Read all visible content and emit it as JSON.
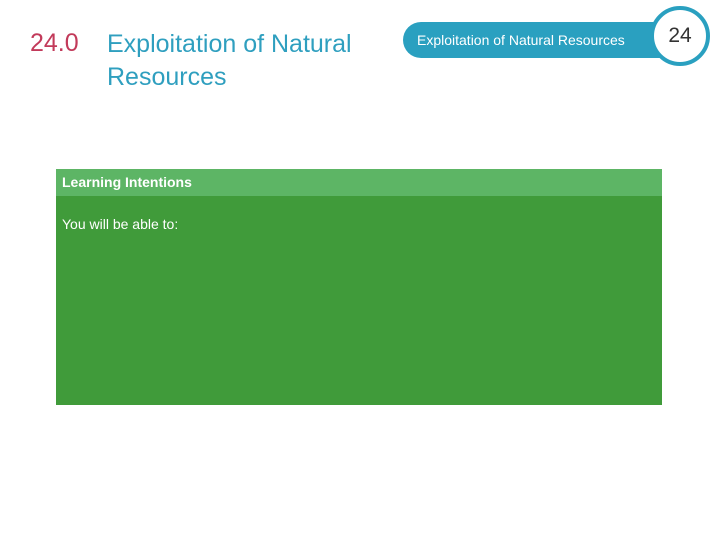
{
  "title": {
    "number": "24.0",
    "text": "Exploitation of Natural Resources"
  },
  "header": {
    "label": "Exploitation of Natural Resources",
    "chapter_number": "24",
    "accent_color": "#2aa0c0"
  },
  "learning_box": {
    "heading": "Learning Intentions",
    "intro": "You will be able to:",
    "body_color": "#409b3a",
    "header_color": "#5db565"
  }
}
